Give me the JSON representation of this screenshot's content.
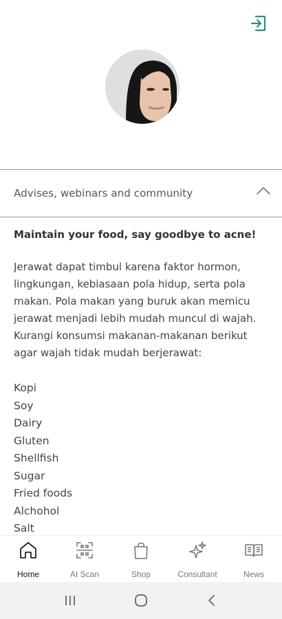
{
  "colors": {
    "accent": "#2f8f7a",
    "divider": "#9a9a9a"
  },
  "header": {
    "logout_icon": "logout-icon"
  },
  "profile": {
    "avatar_icon": "avatar"
  },
  "accordion": {
    "title": "Advises, webinars and community",
    "expanded": true
  },
  "article": {
    "title": "Maintain your food, say goodbye to acne!",
    "body": "Jerawat dapat timbul karena faktor hormon, lingkungan, kebiasaan pola hidup, serta pola makan. Pola makan yang buruk akan memicu jerawat menjadi lebih mudah muncul di wajah. Kurangi konsumsi makanan-makanan berikut agar wajah tidak mudah berjerawat:",
    "foods": [
      "Kopi",
      "Soy",
      "Dairy",
      "Gluten",
      "Shellfish",
      "Sugar",
      "Fried foods",
      "Alchohol",
      "Salt"
    ]
  },
  "bottom_nav": {
    "items": [
      {
        "label": "Home",
        "icon": "home-icon",
        "active": true
      },
      {
        "label": "AI Scan",
        "icon": "scan-icon",
        "active": false
      },
      {
        "label": "Shop",
        "icon": "shopping-bag-icon",
        "active": false
      },
      {
        "label": "Consultant",
        "icon": "sparkle-icon",
        "active": false
      },
      {
        "label": "News",
        "icon": "book-icon",
        "active": false
      }
    ]
  },
  "system_nav": {
    "icons": [
      "recent-apps-icon",
      "home-circle-icon",
      "back-icon"
    ]
  }
}
